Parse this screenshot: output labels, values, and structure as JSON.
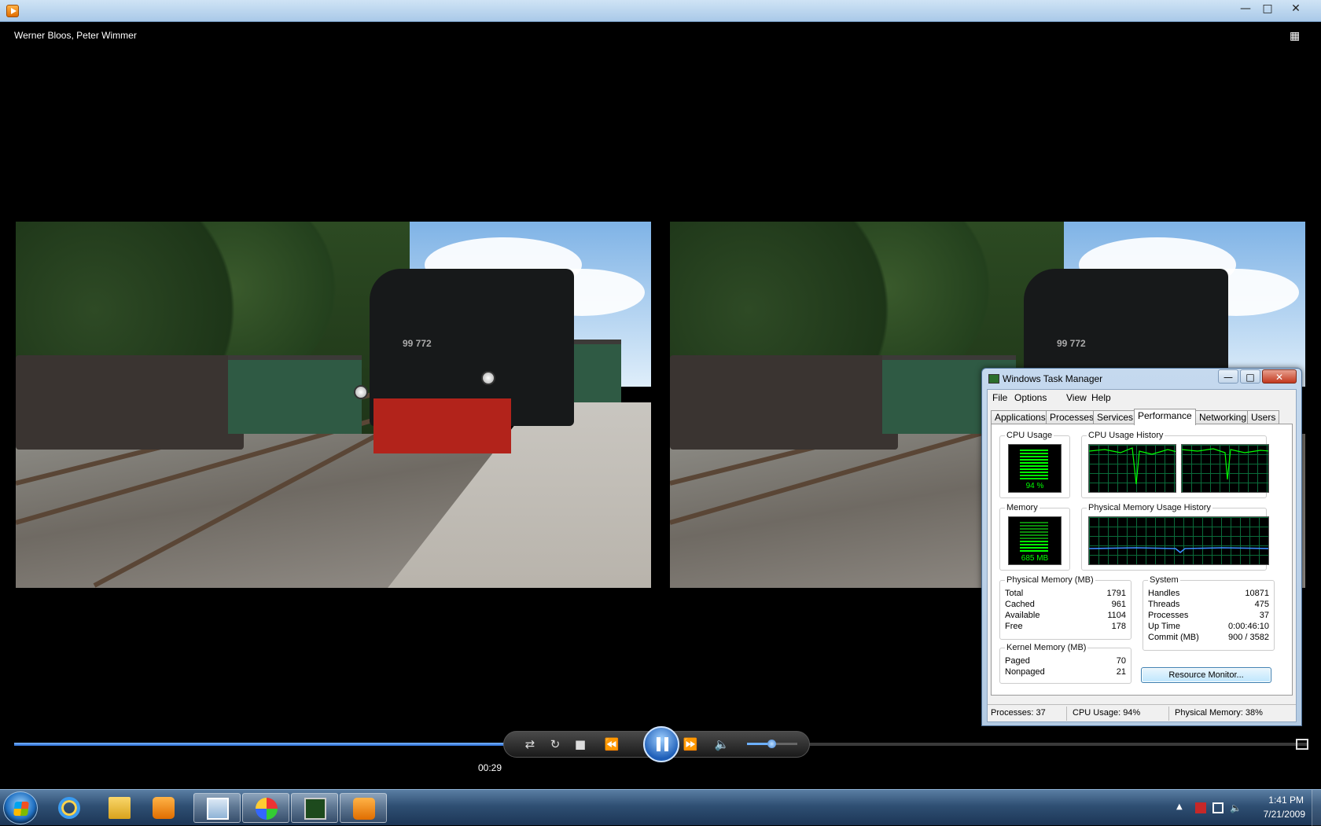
{
  "player": {
    "media_title": "Werner Bloos, Peter Wimmer",
    "time_elapsed": "00:29",
    "progress_percent": 47,
    "volume_percent": 48,
    "icons": [
      "media-player-icon",
      "minimize-icon",
      "maximize-icon",
      "close-icon",
      "switch-to-library-icon",
      "shuffle-icon",
      "repeat-icon",
      "stop-icon",
      "previous-icon",
      "pause-icon",
      "next-icon",
      "volume-icon",
      "fullscreen-icon"
    ],
    "video": {
      "locomotive_number": "99 772"
    }
  },
  "taskmanager": {
    "title": "Windows Task Manager",
    "menu": [
      "File",
      "Options",
      "View",
      "Help"
    ],
    "tabs": [
      "Applications",
      "Processes",
      "Services",
      "Performance",
      "Networking",
      "Users"
    ],
    "active_tab": "Performance",
    "cpu_usage_label": "CPU Usage",
    "cpu_usage_value": "94 %",
    "cpu_history_label": "CPU Usage History",
    "memory_label": "Memory",
    "memory_value": "685 MB",
    "memory_history_label": "Physical Memory Usage History",
    "physical_memory": {
      "label": "Physical Memory (MB)",
      "rows": [
        {
          "k": "Total",
          "v": "1791"
        },
        {
          "k": "Cached",
          "v": "961"
        },
        {
          "k": "Available",
          "v": "1104"
        },
        {
          "k": "Free",
          "v": "178"
        }
      ]
    },
    "system": {
      "label": "System",
      "rows": [
        {
          "k": "Handles",
          "v": "10871"
        },
        {
          "k": "Threads",
          "v": "475"
        },
        {
          "k": "Processes",
          "v": "37"
        },
        {
          "k": "Up Time",
          "v": "0:00:46:10"
        },
        {
          "k": "Commit (MB)",
          "v": "900 / 3582"
        }
      ]
    },
    "kernel_memory": {
      "label": "Kernel Memory (MB)",
      "rows": [
        {
          "k": "Paged",
          "v": "70"
        },
        {
          "k": "Nonpaged",
          "v": "21"
        }
      ]
    },
    "resource_monitor_button": "Resource Monitor...",
    "status": {
      "processes": "Processes: 37",
      "cpu": "CPU Usage: 94%",
      "memory": "Physical Memory: 38%"
    }
  },
  "taskbar": {
    "time": "1:41 PM",
    "date": "7/21/2009",
    "pinned": [
      "internet-explorer-icon",
      "windows-explorer-icon",
      "media-player-icon",
      "remote-desktop-icon",
      "paint-icon",
      "task-manager-icon",
      "media-player-icon"
    ]
  },
  "colors": {
    "accent": "#1f6fc1",
    "graph_green": "#00ff00",
    "graph_grid": "#0a6b3a"
  }
}
